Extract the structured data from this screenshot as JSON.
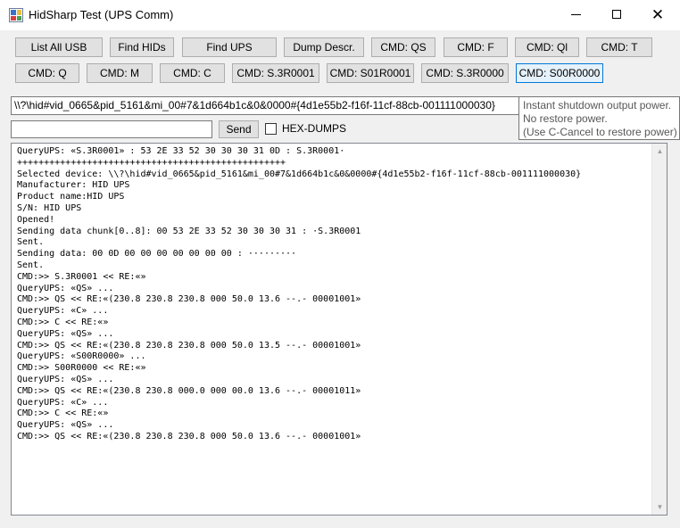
{
  "window": {
    "title": "HidSharp Test (UPS Comm)",
    "app_icon": "app-icon",
    "controls": {
      "minimize": "minimize-icon",
      "maximize": "maximize-icon",
      "close": "close-icon"
    }
  },
  "buttons": {
    "list_all_usb": "List All USB",
    "find_hids": "Find HIDs",
    "find_ups": "Find UPS",
    "dump_descr": "Dump Descr.",
    "cmd_qs": "CMD: QS",
    "cmd_f": "CMD: F",
    "cmd_ql": "CMD: Ql",
    "cmd_t": "CMD: T",
    "cmd_q": "CMD: Q",
    "cmd_m": "CMD: M",
    "cmd_c": "CMD: C",
    "cmd_s3r0001": "CMD: S.3R0001",
    "cmd_s01r0001": "CMD: S01R0001",
    "cmd_s3r0000": "CMD: S.3R0000",
    "cmd_s00r0000": "CMD: S00R0000",
    "send": "Send"
  },
  "device_path": "\\\\?\\hid#vid_0665&pid_5161&mi_00#7&1d664b1c&0&0000#{4d1e55b2-f16f-11cf-88cb-001111000030}",
  "tooltip": {
    "line1": "Instant shutdown output power.",
    "line2": "No restore power.",
    "line3": "(Use C-Cancel to restore power)"
  },
  "command_input": {
    "value": ""
  },
  "hex_dumps": {
    "label": "HEX-DUMPS",
    "checked": false
  },
  "log": {
    "lines": [
      "QueryUPS: «S.3R0001» : 53 2E 33 52 30 30 30 31 0D : S.3R0001·",
      "++++++++++++++++++++++++++++++++++++++++++++++++++",
      "Selected device: \\\\?\\hid#vid_0665&pid_5161&mi_00#7&1d664b1c&0&0000#{4d1e55b2-f16f-11cf-88cb-001111000030}",
      "Manufacturer: HID UPS",
      "Product name:HID UPS",
      "S/N: HID UPS",
      "Opened!",
      "Sending data chunk[0..8]: 00 53 2E 33 52 30 30 30 31 : ·S.3R0001",
      "Sent.",
      "Sending data: 00 0D 00 00 00 00 00 00 00 : ·········",
      "Sent.",
      "CMD:>> S.3R0001 << RE:«»",
      "QueryUPS: «QS» ...",
      "CMD:>> QS << RE:«(230.8 230.8 230.8 000 50.0 13.6 --.- 00001001»",
      "QueryUPS: «C» ...",
      "CMD:>> C << RE:«»",
      "QueryUPS: «QS» ...",
      "CMD:>> QS << RE:«(230.8 230.8 230.8 000 50.0 13.5 --.- 00001001»",
      "QueryUPS: «S00R0000» ...",
      "CMD:>> S00R0000 << RE:«»",
      "QueryUPS: «QS» ...",
      "CMD:>> QS << RE:«(230.8 230.8 000.0 000 00.0 13.6 --.- 00001011»",
      "QueryUPS: «C» ...",
      "CMD:>> C << RE:«»",
      "QueryUPS: «QS» ...",
      "CMD:>> QS << RE:«(230.8 230.8 230.8 000 50.0 13.6 --.- 00001001»"
    ]
  },
  "scrollbar": {
    "up": "scroll-up-arrow-icon",
    "down": "scroll-down-arrow-icon"
  }
}
